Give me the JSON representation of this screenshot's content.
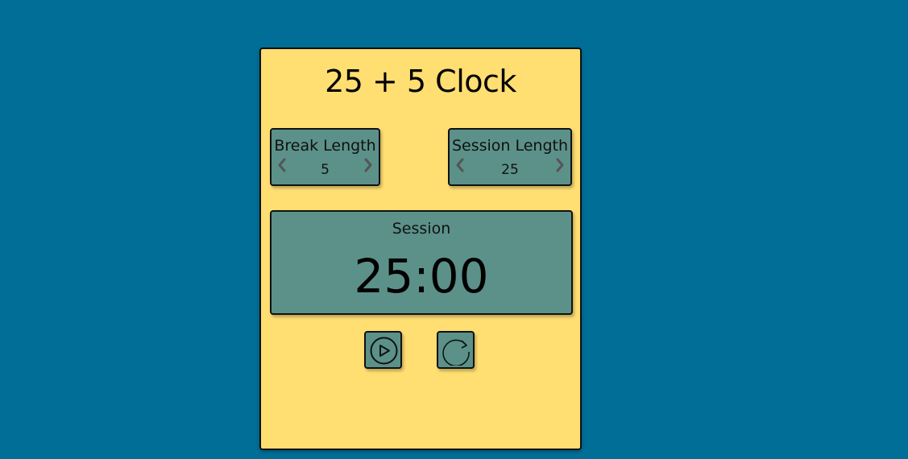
{
  "app": {
    "title": "25 + 5 Clock"
  },
  "break": {
    "label": "Break Length",
    "value": "5",
    "decrement_icon": "chevron-left-icon",
    "increment_icon": "chevron-right-icon"
  },
  "session": {
    "label": "Session Length",
    "value": "25",
    "decrement_icon": "chevron-left-icon",
    "increment_icon": "chevron-right-icon"
  },
  "timer": {
    "label": "Session",
    "time": "25:00"
  },
  "controls": {
    "play_icon": "play-circle-icon",
    "reset_icon": "refresh-icon"
  },
  "colors": {
    "background": "#006e97",
    "card": "#ffde72",
    "panel": "#5b9189",
    "arrow": "#555555"
  }
}
